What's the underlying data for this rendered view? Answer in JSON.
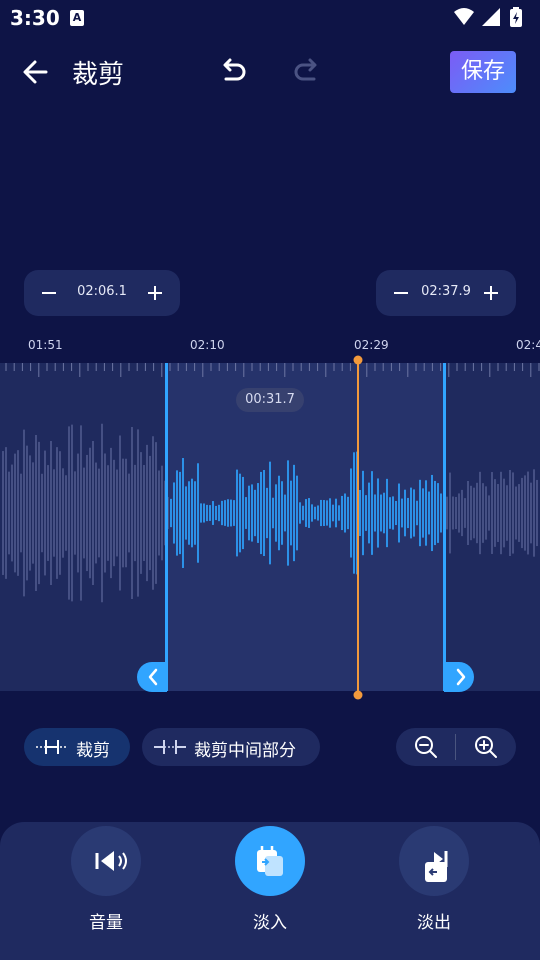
{
  "status_bar": {
    "time": "3:30",
    "notification_letter": "A"
  },
  "header": {
    "title": "裁剪",
    "save_label": "保存"
  },
  "trim": {
    "start_time": "02:06.1",
    "end_time": "02:37.9",
    "duration": "00:31.7"
  },
  "timeline": {
    "ticks": [
      "01:51",
      "02:10",
      "02:29",
      "02:4"
    ]
  },
  "modes": {
    "trim_label": "裁剪",
    "trim_middle_label": "裁剪中间部分"
  },
  "tools": {
    "volume_label": "音量",
    "fade_in_label": "淡入",
    "fade_out_label": "淡出"
  },
  "colors": {
    "background": "#0e1446",
    "accent": "#31a5ff",
    "playhead": "#f39a3c",
    "save_gradient_start": "#7b5cf5",
    "save_gradient_end": "#4d8dfb"
  }
}
